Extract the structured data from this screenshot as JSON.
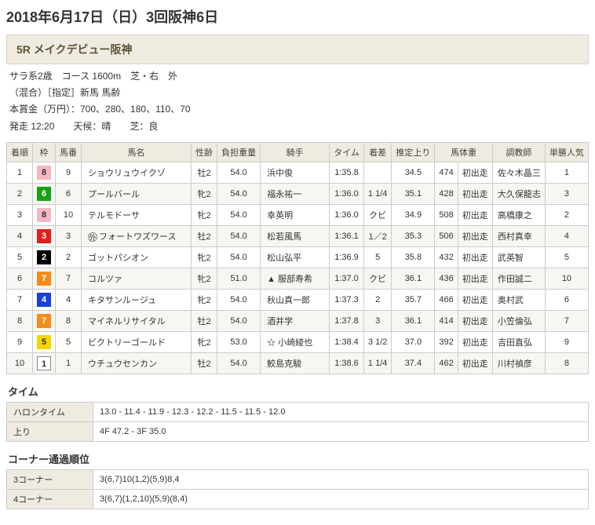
{
  "page_title": "2018年6月17日（日）3回阪神6日",
  "race_header": "5R メイクデビュー阪神",
  "race_info": {
    "line1": "サラ系2歳　コース 1600m　芝・右　外",
    "line2": "（混合）［指定］新馬 馬齢",
    "line3": "本賞金（万円）：700、280、180、110、70",
    "line4": "発走 12:20　　天候：晴　　芝：良"
  },
  "columns": {
    "order": "着順",
    "waku": "枠",
    "num": "馬番",
    "horse": "馬名",
    "sexage": "性齢",
    "weight": "負担重量",
    "jockey": "騎手",
    "time": "タイム",
    "margin": "着差",
    "agari": "推定上り",
    "bweight": "馬体重",
    "trainer": "調教師",
    "pop": "単勝人気"
  },
  "results": [
    {
      "order": "1",
      "waku": 8,
      "num": "9",
      "horse": "ショウリュウイクゾ",
      "sexage": "牡2",
      "weight": "54.0",
      "mark": "",
      "jockey": "浜中俊",
      "time": "1:35.8",
      "margin": "",
      "agari": "34.5",
      "bweight": "474",
      "prev": "初出走",
      "trainer": "佐々木晶三",
      "pop": "1"
    },
    {
      "order": "2",
      "waku": 6,
      "num": "6",
      "horse": "プールバール",
      "sexage": "牝2",
      "weight": "54.0",
      "mark": "",
      "jockey": "福永祐一",
      "time": "1:36.0",
      "margin": "1 1/4",
      "agari": "35.1",
      "bweight": "428",
      "prev": "初出走",
      "trainer": "大久保龍志",
      "pop": "3"
    },
    {
      "order": "3",
      "waku": 8,
      "num": "10",
      "horse": "テルモドーサ",
      "sexage": "牝2",
      "weight": "54.0",
      "mark": "",
      "jockey": "幸英明",
      "time": "1:36.0",
      "margin": "クビ",
      "agari": "34.9",
      "bweight": "508",
      "prev": "初出走",
      "trainer": "高橋康之",
      "pop": "2"
    },
    {
      "order": "4",
      "waku": 3,
      "num": "3",
      "horse": "フォートワズワース",
      "icon": true,
      "sexage": "牡2",
      "weight": "54.0",
      "mark": "",
      "jockey": "松若風馬",
      "time": "1:36.1",
      "margin": "1／2",
      "agari": "35.3",
      "bweight": "506",
      "prev": "初出走",
      "trainer": "西村真幸",
      "pop": "4"
    },
    {
      "order": "5",
      "waku": 2,
      "num": "2",
      "horse": "ゴットパシオン",
      "sexage": "牝2",
      "weight": "54.0",
      "mark": "",
      "jockey": "松山弘平",
      "time": "1:36.9",
      "margin": "5",
      "agari": "35.8",
      "bweight": "432",
      "prev": "初出走",
      "trainer": "武英智",
      "pop": "5"
    },
    {
      "order": "6",
      "waku": 7,
      "num": "7",
      "horse": "コルツァ",
      "sexage": "牝2",
      "weight": "51.0",
      "mark": "▲",
      "jockey": "服部寿希",
      "time": "1:37.0",
      "margin": "クビ",
      "agari": "36.1",
      "bweight": "436",
      "prev": "初出走",
      "trainer": "作田誠二",
      "pop": "10"
    },
    {
      "order": "7",
      "waku": 4,
      "num": "4",
      "horse": "キタサンルージュ",
      "sexage": "牝2",
      "weight": "54.0",
      "mark": "",
      "jockey": "秋山真一郎",
      "time": "1:37.3",
      "margin": "2",
      "agari": "35.7",
      "bweight": "466",
      "prev": "初出走",
      "trainer": "奥村武",
      "pop": "6"
    },
    {
      "order": "8",
      "waku": 7,
      "num": "8",
      "horse": "マイネルリサイタル",
      "sexage": "牡2",
      "weight": "54.0",
      "mark": "",
      "jockey": "酒井学",
      "time": "1:37.8",
      "margin": "3",
      "agari": "36.1",
      "bweight": "414",
      "prev": "初出走",
      "trainer": "小笠倫弘",
      "pop": "7"
    },
    {
      "order": "9",
      "waku": 5,
      "num": "5",
      "horse": "ビクトリーゴールド",
      "sexage": "牝2",
      "weight": "53.0",
      "mark": "☆",
      "jockey": "小崎綾也",
      "time": "1:38.4",
      "margin": "3 1/2",
      "agari": "37.0",
      "bweight": "392",
      "prev": "初出走",
      "trainer": "吉田直弘",
      "pop": "9"
    },
    {
      "order": "10",
      "waku": 1,
      "num": "1",
      "horse": "ウチュウセンカン",
      "sexage": "牡2",
      "weight": "54.0",
      "mark": "",
      "jockey": "鮫島克駿",
      "time": "1:38.6",
      "margin": "1 1/4",
      "agari": "37.4",
      "bweight": "462",
      "prev": "初出走",
      "trainer": "川村禎彦",
      "pop": "8"
    }
  ],
  "time_section": {
    "title": "タイム",
    "rows": [
      {
        "label": "ハロンタイム",
        "value": "13.0 - 11.4 - 11.9 - 12.3 - 12.2 - 11.5 - 11.5 - 12.0"
      },
      {
        "label": "上り",
        "value": "4F 47.2 - 3F 35.0"
      }
    ]
  },
  "corner_section": {
    "title": "コーナー通過順位",
    "rows": [
      {
        "label": "3コーナー",
        "value": "3(6,7)10(1,2)(5,9)8,4"
      },
      {
        "label": "4コーナー",
        "value": "3(6,7)(1,2,10)(5,9)(8,4)"
      }
    ]
  }
}
